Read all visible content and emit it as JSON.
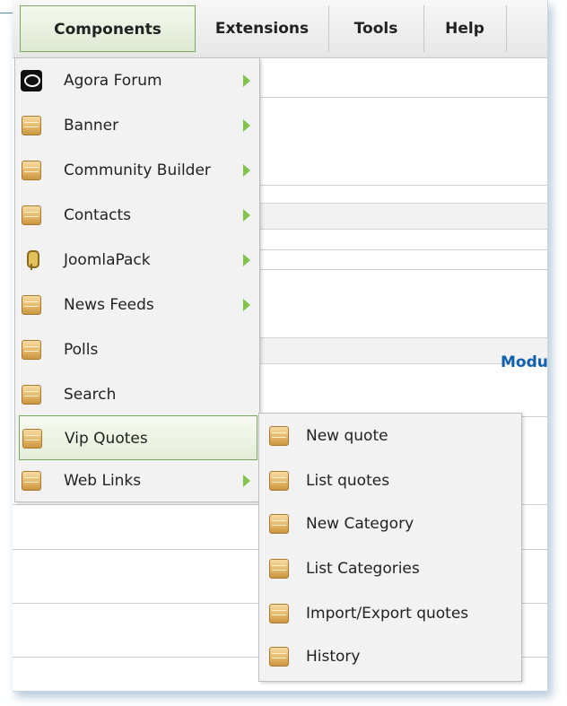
{
  "menubar": {
    "items": [
      {
        "label": "Components",
        "active": true
      },
      {
        "label": "Extensions",
        "active": false
      },
      {
        "label": "Tools",
        "active": false
      },
      {
        "label": "Help",
        "active": false
      }
    ]
  },
  "background": {
    "partial_text": "Modul"
  },
  "components_menu": {
    "items": [
      {
        "label": "Agora Forum",
        "icon": "agora-icon",
        "has_submenu": true
      },
      {
        "label": "Banner",
        "icon": "folder-icon",
        "has_submenu": true
      },
      {
        "label": "Community Builder",
        "icon": "folder-icon",
        "has_submenu": true
      },
      {
        "label": "Contacts",
        "icon": "folder-icon",
        "has_submenu": true
      },
      {
        "label": "JoomlaPack",
        "icon": "joomlapack-icon",
        "has_submenu": true
      },
      {
        "label": "News Feeds",
        "icon": "folder-icon",
        "has_submenu": true
      },
      {
        "label": "Polls",
        "icon": "folder-icon",
        "has_submenu": false
      },
      {
        "label": "Search",
        "icon": "folder-icon",
        "has_submenu": false
      },
      {
        "label": "Vip Quotes",
        "icon": "folder-icon",
        "has_submenu": false,
        "selected": true
      },
      {
        "label": "Web Links",
        "icon": "folder-icon",
        "has_submenu": true
      }
    ]
  },
  "vip_quotes_submenu": {
    "items": [
      {
        "label": "New quote",
        "icon": "folder-icon"
      },
      {
        "label": "List quotes",
        "icon": "folder-icon"
      },
      {
        "label": "New Category",
        "icon": "folder-icon"
      },
      {
        "label": "List Categories",
        "icon": "folder-icon"
      },
      {
        "label": "Import/Export quotes",
        "icon": "folder-icon"
      },
      {
        "label": "History",
        "icon": "folder-icon"
      }
    ]
  },
  "colors": {
    "accent_green": "#84c34a",
    "active_border": "#7aa660",
    "link_blue": "#1060b0"
  }
}
